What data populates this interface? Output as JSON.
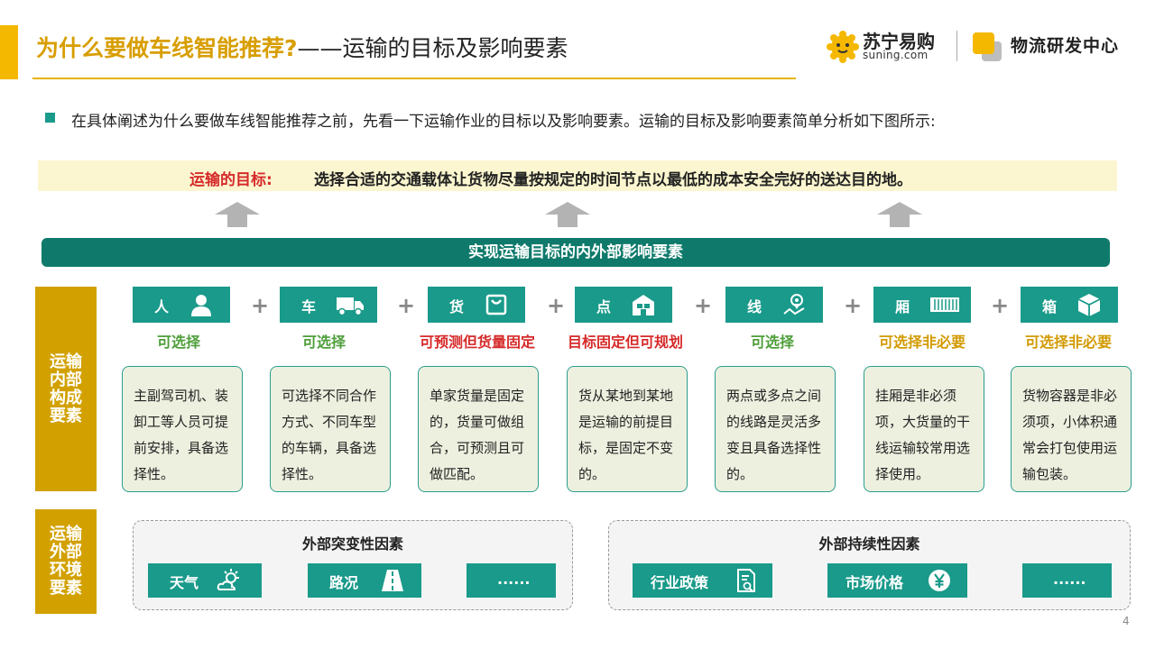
{
  "header": {
    "title_main": "为什么要做车线智能推荐?",
    "title_sub": "——运输的目标及影响要素"
  },
  "brand": {
    "company_cn": "苏宁易购",
    "company_en": "suning.com",
    "department": "物流研发中心"
  },
  "intro": "在具体阐述为什么要做车线智能推荐之前，先看一下运输作业的目标以及影响要素。运输的目标及影响要素简单分析如下图所示:",
  "goal": {
    "label": "运输的目标:",
    "text": "选择合适的交通载体让货物尽量按规定的时间节点以最低的成本安全完好的送达目的地。"
  },
  "factors_title": "实现运输目标的内外部影响要素",
  "internal": {
    "side_label": "运输内部构成要素",
    "factors": [
      {
        "name": "人",
        "icon": "person-icon",
        "status": "可选择",
        "status_color": "#4e9e3a",
        "desc": "主副驾司机、装卸工等人员可提前安排，具备选择性。"
      },
      {
        "name": "车",
        "icon": "truck-icon",
        "status": "可选择",
        "status_color": "#4e9e3a",
        "desc": "可选择不同合作方式、不同车型的车辆，具备选择性。"
      },
      {
        "name": "货",
        "icon": "shopping-bag-icon",
        "status": "可预测但货量固定",
        "status_color": "#d62a2a",
        "desc": "单家货量是固定的，货量可做组合，可预测且可做匹配。"
      },
      {
        "name": "点",
        "icon": "warehouse-icon",
        "status": "目标固定但可规划",
        "status_color": "#d62a2a",
        "desc": "货从某地到某地是运输的前提目标，是固定不变的。"
      },
      {
        "name": "线",
        "icon": "map-route-icon",
        "status": "可选择",
        "status_color": "#4e9e3a",
        "desc": "两点或多点之间的线路是灵活多变且具备选择性的。"
      },
      {
        "name": "厢",
        "icon": "container-icon",
        "status": "可选择非必要",
        "status_color": "#d29a00",
        "desc": "挂厢是非必须项，大货量的干线运输较常用选择使用。"
      },
      {
        "name": "箱",
        "icon": "box-icon",
        "status": "可选择非必要",
        "status_color": "#d29a00",
        "desc": "货物容器是非必须项，小体积通常会打包使用运输包装。"
      }
    ]
  },
  "external": {
    "side_label": "运输外部环境要素",
    "sudden": {
      "title": "外部突变性因素",
      "items": [
        {
          "label": "天气",
          "icon": "weather-icon"
        },
        {
          "label": "路况",
          "icon": "road-icon"
        },
        {
          "label": "......",
          "icon": ""
        }
      ]
    },
    "persistent": {
      "title": "外部持续性因素",
      "items": [
        {
          "label": "行业政策",
          "icon": "policy-document-icon"
        },
        {
          "label": "市场价格",
          "icon": "yen-price-icon"
        },
        {
          "label": "......",
          "icon": ""
        }
      ]
    }
  },
  "page_number": "4"
}
